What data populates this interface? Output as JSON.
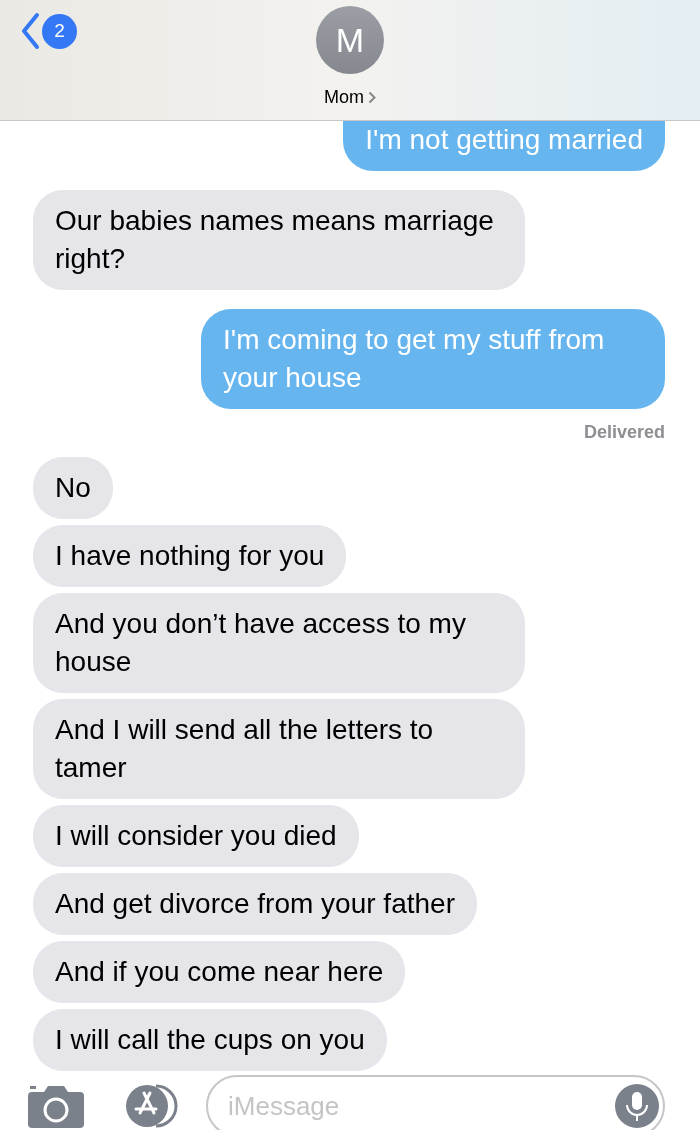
{
  "header": {
    "back_badge": "2",
    "avatar_initial": "M",
    "contact_name": "Mom"
  },
  "messages": [
    {
      "kind": "sent",
      "text": "I'm not getting married"
    },
    {
      "kind": "received",
      "text": "Our babies names means marriage right?"
    },
    {
      "kind": "sent",
      "text": "I'm coming to get my stuff from your house",
      "status": "Delivered"
    },
    {
      "kind": "received",
      "text": "No"
    },
    {
      "kind": "received",
      "text": "I have nothing for you"
    },
    {
      "kind": "received",
      "text": "And you don’t have access to my house"
    },
    {
      "kind": "received",
      "text": "And I will send all the letters to tamer"
    },
    {
      "kind": "received",
      "text": "I will consider you died"
    },
    {
      "kind": "received",
      "text": "And get divorce from your father"
    },
    {
      "kind": "received",
      "text": "And if you come near here"
    },
    {
      "kind": "received",
      "text": "I will call the cups on you"
    }
  ],
  "composer": {
    "placeholder": "iMessage"
  }
}
